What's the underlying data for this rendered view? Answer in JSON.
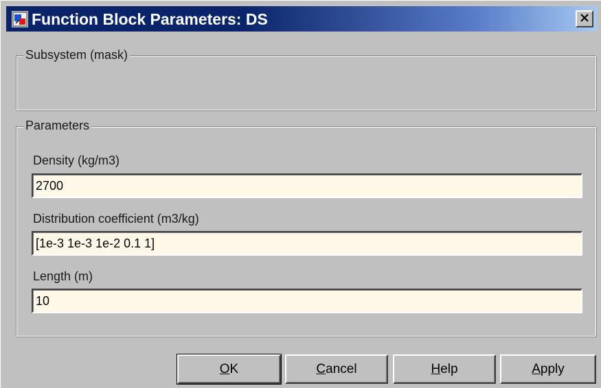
{
  "window": {
    "title": "Function Block Parameters: DS",
    "close_label": "×"
  },
  "subsystem": {
    "legend": "Subsystem (mask)"
  },
  "parameters": {
    "legend": "Parameters",
    "fields": [
      {
        "label": "Density (kg/m3)",
        "value": "2700"
      },
      {
        "label": "Distribution coefficient (m3/kg)",
        "value": "[1e-3 1e-3 1e-2 0.1 1]"
      },
      {
        "label": "Length (m)",
        "value": "10"
      }
    ]
  },
  "buttons": {
    "ok": {
      "mnemonic": "O",
      "rest": "K"
    },
    "cancel": {
      "mnemonic": "C",
      "rest": "ancel"
    },
    "help": {
      "mnemonic": "H",
      "rest": "elp"
    },
    "apply": {
      "mnemonic": "A",
      "rest": "pply"
    }
  },
  "colors": {
    "title_bar": "#0a246a",
    "dialog_face": "#c0c0c0",
    "input_background": "#fff8e8"
  },
  "icons": {
    "app": "simulink-block-icon",
    "close": "close-icon"
  }
}
